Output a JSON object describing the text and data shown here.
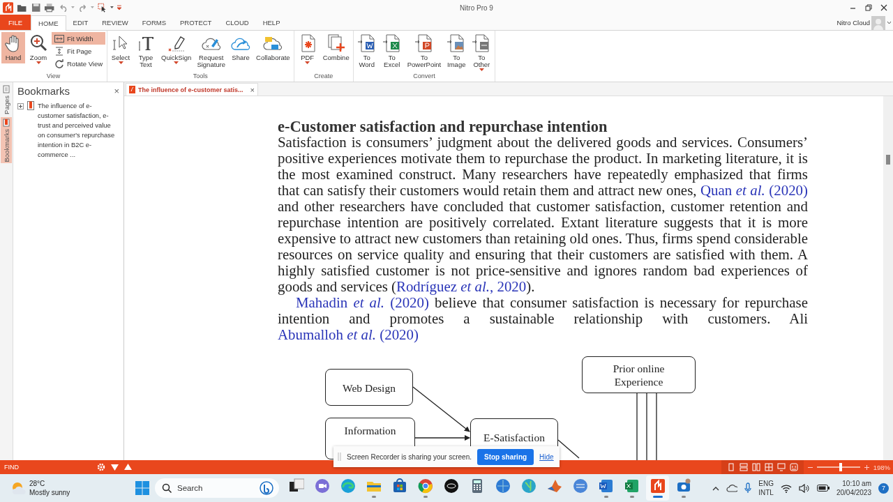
{
  "window": {
    "title": "Nitro Pro 9"
  },
  "menu_tabs": [
    {
      "label": "FILE",
      "kind": "file",
      "selected": false
    },
    {
      "label": "HOME",
      "kind": "tab",
      "selected": true
    },
    {
      "label": "EDIT",
      "kind": "tab",
      "selected": false
    },
    {
      "label": "REVIEW",
      "kind": "tab",
      "selected": false
    },
    {
      "label": "FORMS",
      "kind": "tab",
      "selected": false
    },
    {
      "label": "PROTECT",
      "kind": "tab",
      "selected": false
    },
    {
      "label": "CLOUD",
      "kind": "tab",
      "selected": false
    },
    {
      "label": "HELP",
      "kind": "tab",
      "selected": false
    }
  ],
  "account": {
    "label": "Nitro Cloud"
  },
  "ribbon_groups": [
    {
      "label": "View",
      "buttons": [
        {
          "label": "Hand",
          "kind": "large",
          "dropdown": false,
          "selected": true
        },
        {
          "label": "Zoom",
          "kind": "large",
          "dropdown": true,
          "selected": false
        },
        {
          "label": "Fit Width",
          "kind": "small",
          "dropdown": false,
          "selected": true
        },
        {
          "label": "Fit Page",
          "kind": "small",
          "dropdown": false,
          "selected": false
        },
        {
          "label": "Rotate View",
          "kind": "small",
          "dropdown": false,
          "selected": false
        }
      ]
    },
    {
      "label": "Tools",
      "buttons": [
        {
          "label": "Select",
          "kind": "large",
          "dropdown": true,
          "selected": false
        },
        {
          "label": "Type Text",
          "kind": "large",
          "dropdown": false,
          "selected": false
        },
        {
          "label": "QuickSign",
          "kind": "large",
          "dropdown": true,
          "selected": false
        },
        {
          "label": "Request Signature",
          "kind": "large",
          "dropdown": false,
          "selected": false
        },
        {
          "label": "Share",
          "kind": "large",
          "dropdown": false,
          "selected": false
        },
        {
          "label": "Collaborate",
          "kind": "large",
          "dropdown": false,
          "selected": false
        }
      ]
    },
    {
      "label": "Create",
      "buttons": [
        {
          "label": "PDF",
          "kind": "large",
          "dropdown": true,
          "selected": false
        },
        {
          "label": "Combine",
          "kind": "large",
          "dropdown": false,
          "selected": false
        }
      ]
    },
    {
      "label": "Convert",
      "buttons": [
        {
          "label": "To Word",
          "kind": "large",
          "dropdown": false,
          "selected": false
        },
        {
          "label": "To Excel",
          "kind": "large",
          "dropdown": false,
          "selected": false
        },
        {
          "label": "To PowerPoint",
          "kind": "large",
          "dropdown": false,
          "selected": false
        },
        {
          "label": "To Image",
          "kind": "large",
          "dropdown": false,
          "selected": false
        },
        {
          "label": "To Other",
          "kind": "large",
          "dropdown": true,
          "selected": false
        }
      ]
    }
  ],
  "side_tabs": [
    {
      "label": "Pages",
      "selected": false
    },
    {
      "label": "Bookmarks",
      "selected": true
    }
  ],
  "bookmarks_panel": {
    "title": "Bookmarks",
    "close_label": "×",
    "items": [
      {
        "label": "The influence of e-customer satisfaction, e-trust and perceived value on consumer's repurchase intention in B2C e-commerce  ...",
        "expanded": false
      }
    ]
  },
  "document_tab": {
    "title": "The influence of e-customer satis...",
    "close_label": "×"
  },
  "document": {
    "heading": "e-Customer satisfaction and repurchase intention",
    "paragraphs": [
      {
        "indent": false,
        "segments": [
          {
            "kind": "text",
            "text": "Satisfaction is consumers’ judgment about the delivered goods and services. Consumers’ positive experiences motivate them to repurchase the product. In marketing literature, it is the most examined construct. Many researchers have repeatedly emphasized that firms that can satisfy their customers would retain them and attract new ones, "
          },
          {
            "kind": "link",
            "text": "Quan *et al.* (2020)"
          },
          {
            "kind": "text",
            "text": " and other researchers have concluded that customer satisfaction, customer retention and repurchase intention are positively correlated. Extant literature suggests that it is more expensive to attract new customers than retaining old ones. Thus, firms spend considerable resources on service quality and ensuring that their customers are satisfied with them. A highly satisfied customer is not price-sensitive and ignores random bad experiences of goods and services ("
          },
          {
            "kind": "link",
            "text": "Rodríguez *et al.*, 2020"
          },
          {
            "kind": "text",
            "text": ")."
          }
        ]
      },
      {
        "indent": true,
        "segments": [
          {
            "kind": "link",
            "text": "Mahadin *et al.* (2020)"
          },
          {
            "kind": "text",
            "text": " believe that consumer satisfaction is necessary for repurchase intention and promotes a sustainable relationship with customers. Ali "
          },
          {
            "kind": "link",
            "text": "Abumalloh *et al.* (2020)"
          }
        ]
      }
    ]
  },
  "figure": {
    "nodes": [
      {
        "label": "Web Design"
      },
      {
        "label": "Information"
      },
      {
        "label": "E-Satisfaction"
      },
      {
        "label": "Prior online Experience"
      }
    ]
  },
  "status_bar": {
    "find_label": "FIND",
    "zoom": {
      "level": 0.55,
      "reading": "198%"
    }
  },
  "screen_share_notice": {
    "message": "Screen Recorder is sharing your screen.",
    "stop_button": "Stop sharing",
    "hide_link": "Hide"
  },
  "taskbar": {
    "weather": {
      "temperature": "28°C",
      "condition": "Mostly sunny"
    },
    "search": {
      "placeholder": "Search"
    },
    "apps": [
      {
        "running": false,
        "selected": false
      },
      {
        "running": false,
        "selected": false
      },
      {
        "running": false,
        "selected": false
      },
      {
        "running": true,
        "selected": false
      },
      {
        "running": false,
        "selected": false
      },
      {
        "running": true,
        "selected": false
      },
      {
        "running": false,
        "selected": false
      },
      {
        "running": false,
        "selected": false
      },
      {
        "running": false,
        "selected": false
      },
      {
        "running": false,
        "selected": false
      },
      {
        "running": false,
        "selected": false
      },
      {
        "running": false,
        "selected": false
      },
      {
        "running": true,
        "selected": false
      },
      {
        "running": true,
        "selected": false
      },
      {
        "running": true,
        "selected": true
      },
      {
        "running": true,
        "selected": false
      }
    ],
    "language": "ENG",
    "layout": "INTL",
    "time": "10:10 am",
    "date": "20/04/2023",
    "notifications": "7"
  }
}
